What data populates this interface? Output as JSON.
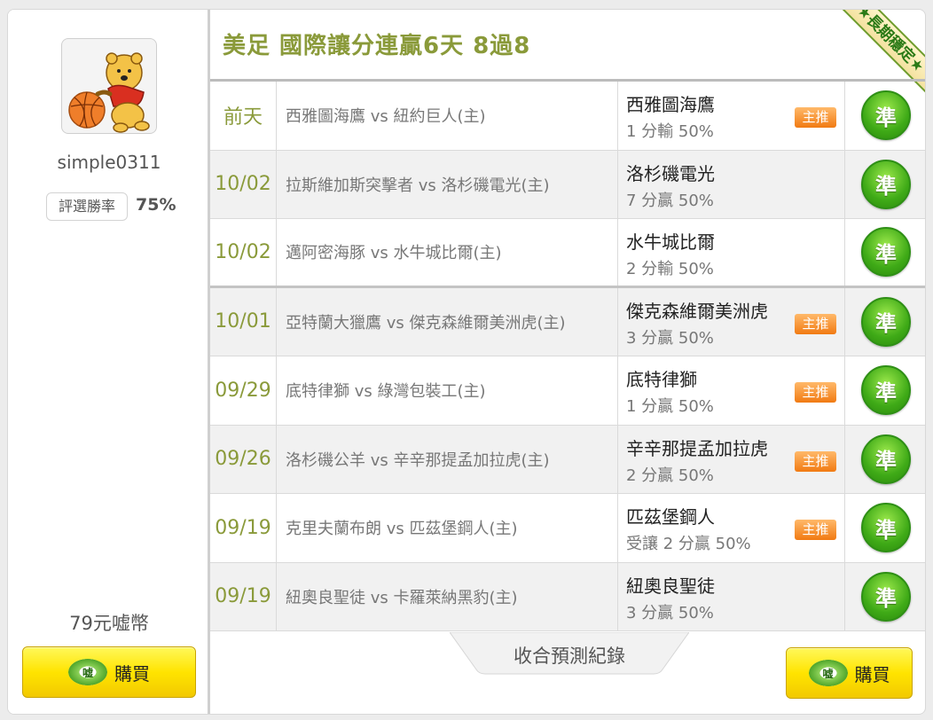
{
  "sidebar": {
    "username": "simple0311",
    "rate_label": "評選勝率",
    "rate_value": "75%",
    "price": "79元嘘幣",
    "buy_label": "購買",
    "coin_text": "嘘"
  },
  "main": {
    "title": "美足 國際讓分連贏6天 8過8",
    "ribbon": "★長期穩定★",
    "collapse_label": "收合預測紀錄",
    "buy_label": "購買",
    "rows": [
      {
        "date": "前天",
        "match": "西雅圖海鷹 vs 紐約巨人(主)",
        "pick_team": "西雅圖海鷹",
        "pick_detail": "1 分輸 50%",
        "tag": "主推",
        "result": "準"
      },
      {
        "date": "10/02",
        "match": "拉斯維加斯突擊者 vs 洛杉磯電光(主)",
        "pick_team": "洛杉磯電光",
        "pick_detail": "7 分贏 50%",
        "tag": "",
        "result": "準"
      },
      {
        "date": "10/02",
        "match": "邁阿密海豚 vs 水牛城比爾(主)",
        "pick_team": "水牛城比爾",
        "pick_detail": "2 分輸 50%",
        "tag": "",
        "result": "準"
      },
      {
        "date": "10/01",
        "match": "亞特蘭大獵鷹 vs 傑克森維爾美洲虎(主)",
        "pick_team": "傑克森維爾美洲虎",
        "pick_detail": "3 分贏 50%",
        "tag": "主推",
        "result": "準"
      },
      {
        "date": "09/29",
        "match": "底特律獅 vs 綠灣包裝工(主)",
        "pick_team": "底特律獅",
        "pick_detail": "1 分贏 50%",
        "tag": "主推",
        "result": "準"
      },
      {
        "date": "09/26",
        "match": "洛杉磯公羊 vs 辛辛那提孟加拉虎(主)",
        "pick_team": "辛辛那提孟加拉虎",
        "pick_detail": "2 分贏 50%",
        "tag": "主推",
        "result": "準"
      },
      {
        "date": "09/19",
        "match": "克里夫蘭布朗 vs 匹茲堡鋼人(主)",
        "pick_team": "匹茲堡鋼人",
        "pick_detail": "受讓 2 分贏 50%",
        "tag": "主推",
        "result": "準"
      },
      {
        "date": "09/19",
        "match": "紐奧良聖徒 vs 卡羅萊納黑豹(主)",
        "pick_team": "紐奧良聖徒",
        "pick_detail": "3 分贏 50%",
        "tag": "",
        "result": "準"
      }
    ]
  }
}
